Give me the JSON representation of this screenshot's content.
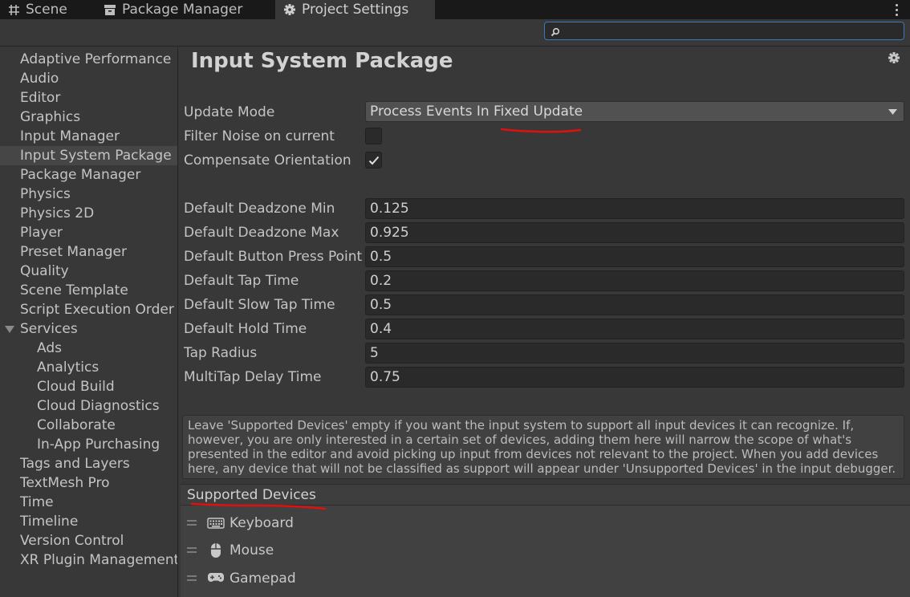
{
  "tabs": [
    {
      "label": "Scene",
      "icon": "grid-icon"
    },
    {
      "label": "Package Manager",
      "icon": "package-icon"
    },
    {
      "label": "Project Settings",
      "icon": "gear-icon",
      "active": true
    }
  ],
  "search": {
    "value": "",
    "placeholder": ""
  },
  "sidebar": {
    "items": [
      {
        "label": "Adaptive Performance"
      },
      {
        "label": "Audio"
      },
      {
        "label": "Editor"
      },
      {
        "label": "Graphics"
      },
      {
        "label": "Input Manager"
      },
      {
        "label": "Input System Package",
        "selected": true
      },
      {
        "label": "Package Manager"
      },
      {
        "label": "Physics"
      },
      {
        "label": "Physics 2D"
      },
      {
        "label": "Player"
      },
      {
        "label": "Preset Manager"
      },
      {
        "label": "Quality"
      },
      {
        "label": "Scene Template"
      },
      {
        "label": "Script Execution Order"
      },
      {
        "label": "Services",
        "expanded": true
      },
      {
        "label": "Ads",
        "child": true
      },
      {
        "label": "Analytics",
        "child": true
      },
      {
        "label": "Cloud Build",
        "child": true
      },
      {
        "label": "Cloud Diagnostics",
        "child": true
      },
      {
        "label": "Collaborate",
        "child": true
      },
      {
        "label": "In-App Purchasing",
        "child": true
      },
      {
        "label": "Tags and Layers"
      },
      {
        "label": "TextMesh Pro"
      },
      {
        "label": "Time"
      },
      {
        "label": "Timeline"
      },
      {
        "label": "Version Control"
      },
      {
        "label": "XR Plugin Management"
      }
    ]
  },
  "main": {
    "title": "Input System Package",
    "update_mode": {
      "label": "Update Mode",
      "value": "Process Events In Fixed Update"
    },
    "filter_noise": {
      "label": "Filter Noise on current",
      "checked": false
    },
    "compensate": {
      "label": "Compensate Orientation",
      "checked": true
    },
    "fields": [
      {
        "label": "Default Deadzone Min",
        "value": "0.125"
      },
      {
        "label": "Default Deadzone Max",
        "value": "0.925"
      },
      {
        "label": "Default Button Press Point",
        "value": "0.5"
      },
      {
        "label": "Default Tap Time",
        "value": "0.2"
      },
      {
        "label": "Default Slow Tap Time",
        "value": "0.5"
      },
      {
        "label": "Default Hold Time",
        "value": "0.4"
      },
      {
        "label": "Tap Radius",
        "value": "5"
      },
      {
        "label": "MultiTap Delay Time",
        "value": "0.75"
      }
    ],
    "help_text": "Leave 'Supported Devices' empty if you want the input system to support all input devices it can recognize. If, however, you are only interested in a certain set of devices, adding them here will narrow the scope of what's presented in the editor and avoid picking up input from devices not relevant to the project. When you add devices here, any device that will not be classified as support will appear under 'Unsupported Devices' in the input debugger.",
    "supported_devices": {
      "header": "Supported Devices",
      "items": [
        {
          "label": "Keyboard",
          "icon": "keyboard-icon"
        },
        {
          "label": "Mouse",
          "icon": "mouse-icon"
        },
        {
          "label": "Gamepad",
          "icon": "gamepad-icon"
        }
      ]
    }
  },
  "colors": {
    "accent": "#3a79bb",
    "annotation": "#e01010",
    "background": "#383838"
  }
}
